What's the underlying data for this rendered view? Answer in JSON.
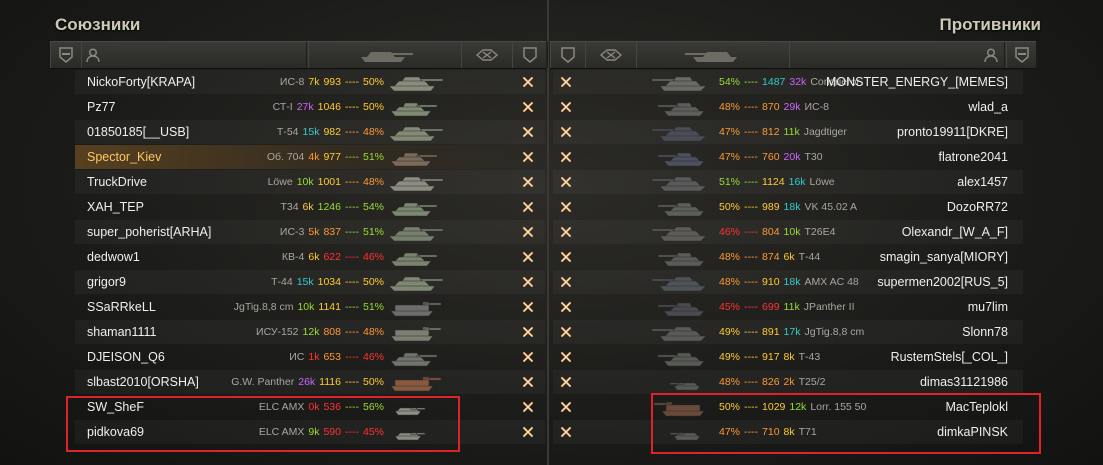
{
  "allies": {
    "title": "Союзники",
    "players": [
      {
        "name": "NickoForty[KRAPA]",
        "vehicle": "ИС-8",
        "s1": "7k",
        "s2": "993",
        "s3": "50%",
        "c1": "#ffcc33",
        "c2": "#ffcc33",
        "c3": "#ffcc33",
        "highlight": false
      },
      {
        "name": "Pz77",
        "vehicle": "СТ-I",
        "s1": "27k",
        "s2": "1046",
        "s3": "50%",
        "c1": "#cc66ff",
        "c2": "#ffcc33",
        "c3": "#ffcc33",
        "highlight": false
      },
      {
        "name": "01850185[__USB]",
        "vehicle": "Т-54",
        "s1": "15k",
        "s2": "982",
        "s3": "48%",
        "c1": "#33cccc",
        "c2": "#ffcc33",
        "c3": "#ff9933",
        "highlight": false
      },
      {
        "name": "Spector_Kiev",
        "vehicle": "Об. 704",
        "s1": "4k",
        "s2": "977",
        "s3": "51%",
        "c1": "#ff9933",
        "c2": "#ffcc33",
        "c3": "#99dd33",
        "highlight": true
      },
      {
        "name": "TruckDrive",
        "vehicle": "Löwe",
        "s1": "10k",
        "s2": "1001",
        "s3": "48%",
        "c1": "#99dd33",
        "c2": "#ffcc33",
        "c3": "#ff9933",
        "highlight": false
      },
      {
        "name": "XAH_TEP",
        "vehicle": "T34",
        "s1": "6k",
        "s2": "1246",
        "s3": "54%",
        "c1": "#ffcc33",
        "c2": "#99dd33",
        "c3": "#99dd33",
        "highlight": false
      },
      {
        "name": "super_poherist[ARHA]",
        "vehicle": "ИС-3",
        "s1": "5k",
        "s2": "837",
        "s3": "51%",
        "c1": "#ff9933",
        "c2": "#ff9933",
        "c3": "#99dd33",
        "highlight": false
      },
      {
        "name": "dedwow1",
        "vehicle": "КВ-4",
        "s1": "6k",
        "s2": "622",
        "s3": "46%",
        "c1": "#ffcc33",
        "c2": "#ff3333",
        "c3": "#ff3333",
        "highlight": false
      },
      {
        "name": "grigor9",
        "vehicle": "Т-44",
        "s1": "15k",
        "s2": "1034",
        "s3": "50%",
        "c1": "#33cccc",
        "c2": "#ffcc33",
        "c3": "#ffcc33",
        "highlight": false
      },
      {
        "name": "SSaRRkeLL",
        "vehicle": "JgTig.8,8 cm",
        "s1": "10k",
        "s2": "1141",
        "s3": "51%",
        "c1": "#99dd33",
        "c2": "#ffcc33",
        "c3": "#99dd33",
        "highlight": false
      },
      {
        "name": "shaman1111",
        "vehicle": "ИСУ-152",
        "s1": "12k",
        "s2": "808",
        "s3": "48%",
        "c1": "#99dd33",
        "c2": "#ff9933",
        "c3": "#ff9933",
        "highlight": false
      },
      {
        "name": "DJEISON_Q6",
        "vehicle": "ИС",
        "s1": "1k",
        "s2": "653",
        "s3": "46%",
        "c1": "#ff3333",
        "c2": "#ff9933",
        "c3": "#ff3333",
        "highlight": false
      },
      {
        "name": "slbast2010[ORSHA]",
        "vehicle": "G.W. Panther",
        "s1": "26k",
        "s2": "1116",
        "s3": "50%",
        "c1": "#cc66ff",
        "c2": "#ffcc33",
        "c3": "#ffcc33",
        "highlight": false
      },
      {
        "name": "SW_SheF",
        "vehicle": "ELC AMX",
        "s1": "0k",
        "s2": "536",
        "s3": "56%",
        "c1": "#ff3333",
        "c2": "#ff3333",
        "c3": "#99dd33",
        "highlight": false
      },
      {
        "name": "pidkova69",
        "vehicle": "ELC AMX",
        "s1": "9k",
        "s2": "590",
        "s3": "45%",
        "c1": "#99dd33",
        "c2": "#ff3333",
        "c3": "#ff3333",
        "highlight": false
      }
    ]
  },
  "enemies": {
    "title": "Противники",
    "players": [
      {
        "name": "MONSTER_ENERGY_[MEMES]",
        "vehicle": "Conqueror",
        "s1": "54%",
        "s2": "1487",
        "s3": "32k",
        "c1": "#99dd33",
        "c2": "#33cccc",
        "c3": "#cc66ff"
      },
      {
        "name": "wlad_a",
        "vehicle": "ИС-8",
        "s1": "48%",
        "s2": "870",
        "s3": "29k",
        "c1": "#ff9933",
        "c2": "#ff9933",
        "c3": "#cc66ff"
      },
      {
        "name": "pronto19911[DKRE]",
        "vehicle": "Jagdtiger",
        "s1": "47%",
        "s2": "812",
        "s3": "11k",
        "c1": "#ff9933",
        "c2": "#ff9933",
        "c3": "#99dd33"
      },
      {
        "name": "flatrone2041",
        "vehicle": "T30",
        "s1": "47%",
        "s2": "760",
        "s3": "20k",
        "c1": "#ff9933",
        "c2": "#ff9933",
        "c3": "#cc66ff"
      },
      {
        "name": "alex1457",
        "vehicle": "Löwe",
        "s1": "51%",
        "s2": "1124",
        "s3": "16k",
        "c1": "#99dd33",
        "c2": "#ffcc33",
        "c3": "#33cccc"
      },
      {
        "name": "DozoRR72",
        "vehicle": "VK 45.02 A",
        "s1": "50%",
        "s2": "989",
        "s3": "18k",
        "c1": "#ffcc33",
        "c2": "#ffcc33",
        "c3": "#33cccc"
      },
      {
        "name": "Olexandr_[W_A_F]",
        "vehicle": "T26E4",
        "s1": "46%",
        "s2": "804",
        "s3": "10k",
        "c1": "#ff3333",
        "c2": "#ff9933",
        "c3": "#99dd33"
      },
      {
        "name": "smagin_sanya[MIORY]",
        "vehicle": "Т-44",
        "s1": "48%",
        "s2": "874",
        "s3": "6k",
        "c1": "#ff9933",
        "c2": "#ff9933",
        "c3": "#ffcc33"
      },
      {
        "name": "supermen2002[RUS_5]",
        "vehicle": "AMX AC 48",
        "s1": "48%",
        "s2": "910",
        "s3": "18k",
        "c1": "#ff9933",
        "c2": "#ffcc33",
        "c3": "#33cccc"
      },
      {
        "name": "mu7lim",
        "vehicle": "JPanther II",
        "s1": "45%",
        "s2": "699",
        "s3": "11k",
        "c1": "#ff3333",
        "c2": "#ff3333",
        "c3": "#99dd33"
      },
      {
        "name": "Slonn78",
        "vehicle": "JgTig.8,8 cm",
        "s1": "49%",
        "s2": "891",
        "s3": "17k",
        "c1": "#ffcc33",
        "c2": "#ffcc33",
        "c3": "#33cccc"
      },
      {
        "name": "RustemStels[_COL_]",
        "vehicle": "Т-43",
        "s1": "49%",
        "s2": "917",
        "s3": "8k",
        "c1": "#ffcc33",
        "c2": "#ffcc33",
        "c3": "#ffcc33"
      },
      {
        "name": "dimas31121986",
        "vehicle": "T25/2",
        "s1": "48%",
        "s2": "826",
        "s3": "2k",
        "c1": "#ff9933",
        "c2": "#ff9933",
        "c3": "#ff9933"
      },
      {
        "name": "MacTeplokl",
        "vehicle": "Lorr. 155 50",
        "s1": "50%",
        "s2": "1029",
        "s3": "12k",
        "c1": "#ffcc33",
        "c2": "#ffcc33",
        "c3": "#99dd33"
      },
      {
        "name": "dimkaPINSK",
        "vehicle": "T71",
        "s1": "47%",
        "s2": "710",
        "s3": "8k",
        "c1": "#ff9933",
        "c2": "#ff9933",
        "c3": "#ffcc33"
      }
    ]
  },
  "separator": "----",
  "colors": {
    "highlight_name": "#ffc764",
    "annotation_box": "#e0222a",
    "title": "#cfc9b8"
  },
  "icons": [
    "shield-icon",
    "player-icon",
    "vehicle-icon",
    "frags-icon",
    "death-cross-icon"
  ]
}
